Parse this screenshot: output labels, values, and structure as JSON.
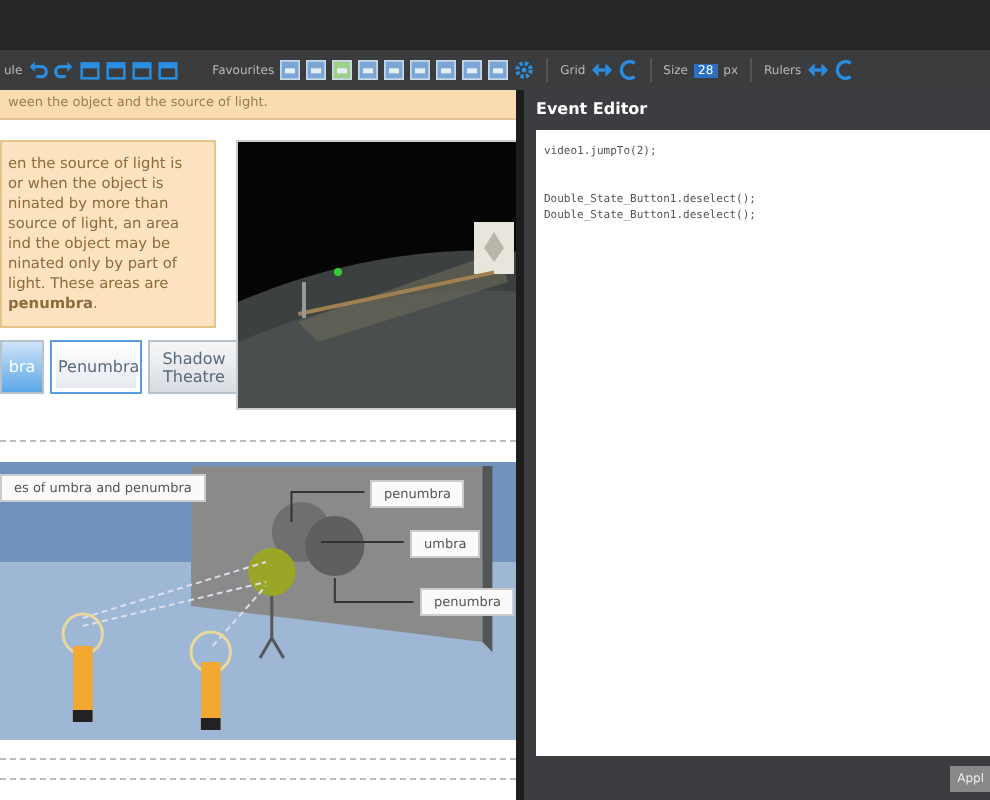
{
  "toolbar": {
    "cut_label": "ule",
    "favourites_label": "Favourites",
    "grid_label": "Grid",
    "size_label": "Size",
    "size_value": "28",
    "size_unit": "px",
    "rulers_label": "Rulers"
  },
  "slide": {
    "top_text": "ween the object and the source of light.",
    "info_text": "en the source of light is\nor when the object is\nninated by more than\n source of light, an area\nind the object may be\nninated only by part of\nlight. These areas are\n**penumbra**.",
    "buttons": [
      {
        "label": "bra",
        "selected": true,
        "focused": false
      },
      {
        "label": "Penumbra",
        "selected": false,
        "focused": true
      },
      {
        "label": "Shadow Theatre",
        "selected": false,
        "focused": false
      }
    ],
    "diagram": {
      "caption": "es of umbra and penumbra",
      "labels": [
        "penumbra",
        "umbra",
        "penumbra"
      ]
    }
  },
  "editor": {
    "title": "Event Editor",
    "lines": [
      {
        "text": "video1.jumpTo(2);",
        "gap_before": false
      },
      {
        "text": "Double_State_Button1.deselect();",
        "gap_before": true
      },
      {
        "text": "Double_State_Button1.deselect();",
        "gap_before": false
      }
    ],
    "apply_label": "Appl"
  }
}
